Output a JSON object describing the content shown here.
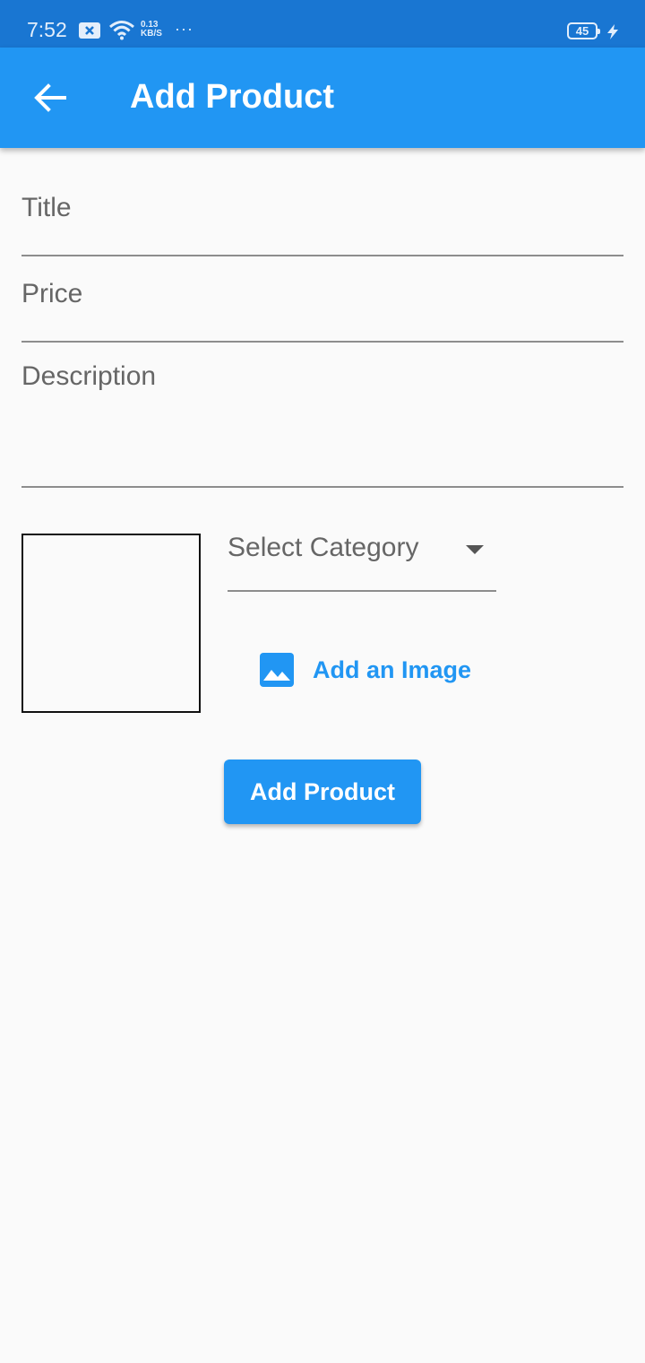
{
  "status_bar": {
    "time": "7:52",
    "net_speed_value": "0.13",
    "net_speed_unit": "KB/S",
    "more": "···",
    "battery": "45",
    "icons": [
      "notification-icon",
      "wifi-icon",
      "battery-icon",
      "charging-icon"
    ],
    "background": "#1976d2"
  },
  "app_bar": {
    "title": "Add Product",
    "back_icon": "arrow-back-icon",
    "background": "#2196f3"
  },
  "form": {
    "title_placeholder": "Title",
    "price_placeholder": "Price",
    "description_placeholder": "Description",
    "category_label": "Select Category",
    "add_image_label": "Add an Image",
    "image_icon": "image-icon",
    "submit_label": "Add Product"
  },
  "colors": {
    "accent": "#2196f3",
    "background": "#fafafa"
  }
}
